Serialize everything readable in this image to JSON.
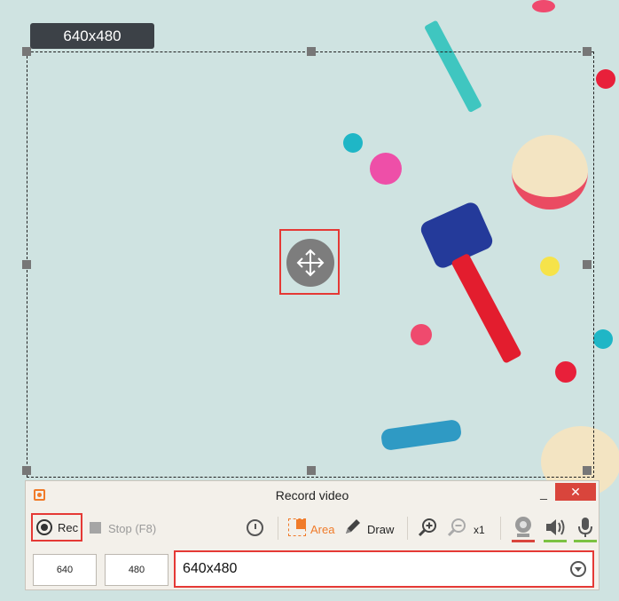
{
  "overlay": {
    "size_label": "640x480"
  },
  "panel": {
    "title": "Record video",
    "minimize_glyph": "_",
    "close_glyph": "✕",
    "toolbar": {
      "rec_label": "Rec",
      "stop_label": "Stop (F8)",
      "area_label": "Area",
      "draw_label": "Draw",
      "zoom_level": "x1"
    },
    "indicators": {
      "webcam_color": "#d9453c",
      "speaker_color": "#7cc242",
      "mic_color": "#7cc242"
    },
    "width_value": "640",
    "height_value": "480",
    "preset_value": "640x480"
  },
  "colors": {
    "accent": "#f07b2a",
    "highlight": "#e53935"
  }
}
